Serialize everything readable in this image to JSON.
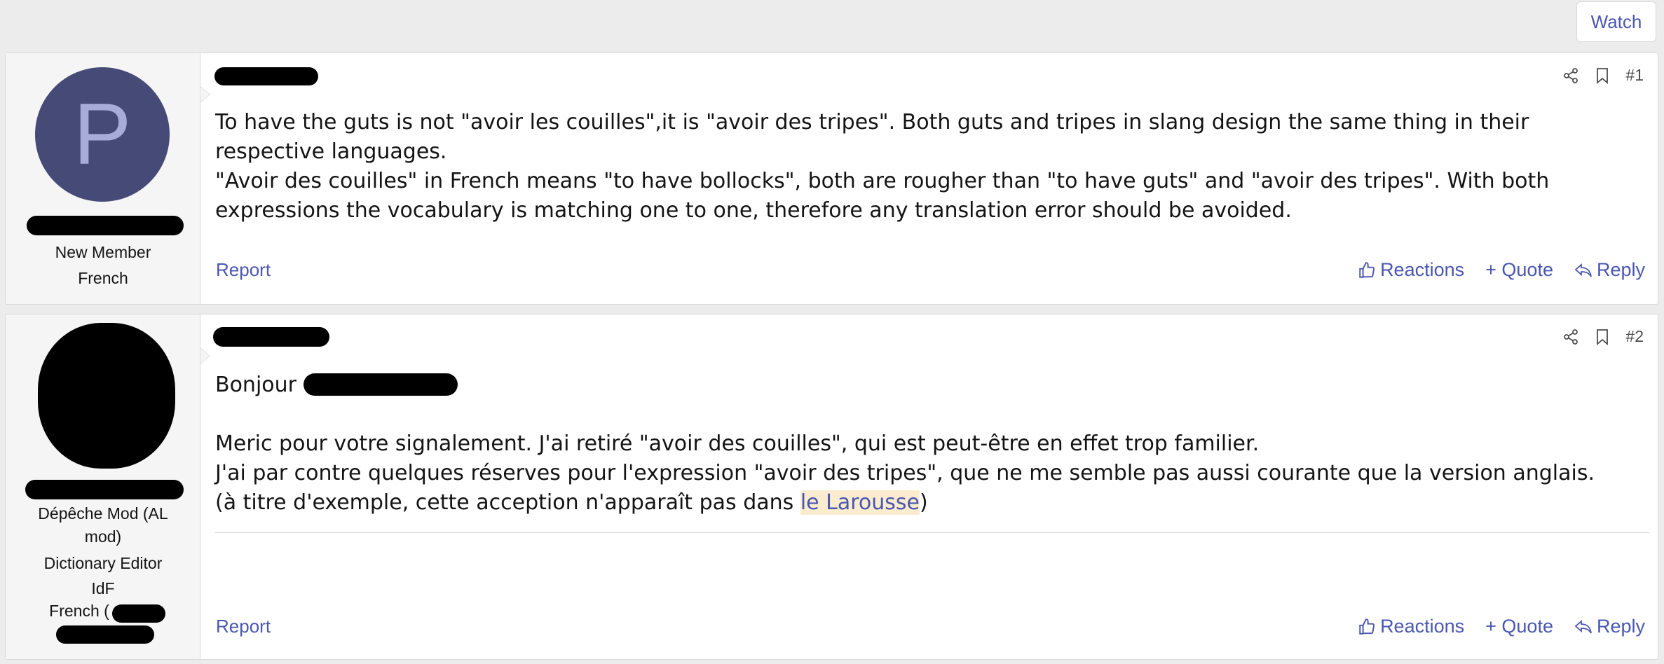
{
  "header": {
    "watch_label": "Watch"
  },
  "posts": [
    {
      "number": "#1",
      "user": {
        "avatar_letter": "P",
        "titles": [
          "New Member",
          "French"
        ]
      },
      "body": [
        "To have the guts is not \"avoir les couilles\",it is \"avoir des tripes\". Both guts and tripes in slang design the same thing in their respective languages.",
        "\"Avoir des couilles\" in French means \"to have bollocks\", both are rougher than \"to have guts\" and \"avoir des tripes\". With both expressions the vocabulary is matching one to one, therefore any translation error should be avoided."
      ],
      "report_label": "Report",
      "actions": {
        "reactions": "Reactions",
        "quote": "+ Quote",
        "reply": "Reply"
      }
    },
    {
      "number": "#2",
      "user": {
        "titles": [
          "Dépêche Mod (AL mod)",
          "Dictionary Editor",
          "IdF",
          "French ("
        ]
      },
      "body": {
        "greeting": "Bonjour",
        "line1": "Meric pour votre signalement. J'ai retiré \"avoir des couilles\", qui est peut-être en effet trop familier.",
        "line2": "J'ai par contre quelques réserves pour l'expression \"avoir des tripes\", que ne me semble pas aussi courante que la version anglais.",
        "line3_prefix": "(à titre d'exemple, cette acception n'apparaît pas dans ",
        "link_text": "le Larousse",
        "line3_suffix": ")"
      },
      "report_label": "Report",
      "actions": {
        "reactions": "Reactions",
        "quote": "+ Quote",
        "reply": "Reply"
      }
    }
  ],
  "icons": {
    "share": "share-icon",
    "bookmark": "bookmark-icon",
    "thumbs_up": "thumbs-up-icon",
    "reply": "reply-icon"
  },
  "colors": {
    "link": "#4a57b0",
    "avatar_bg": "#454a77",
    "highlight": "#fbecd0"
  }
}
